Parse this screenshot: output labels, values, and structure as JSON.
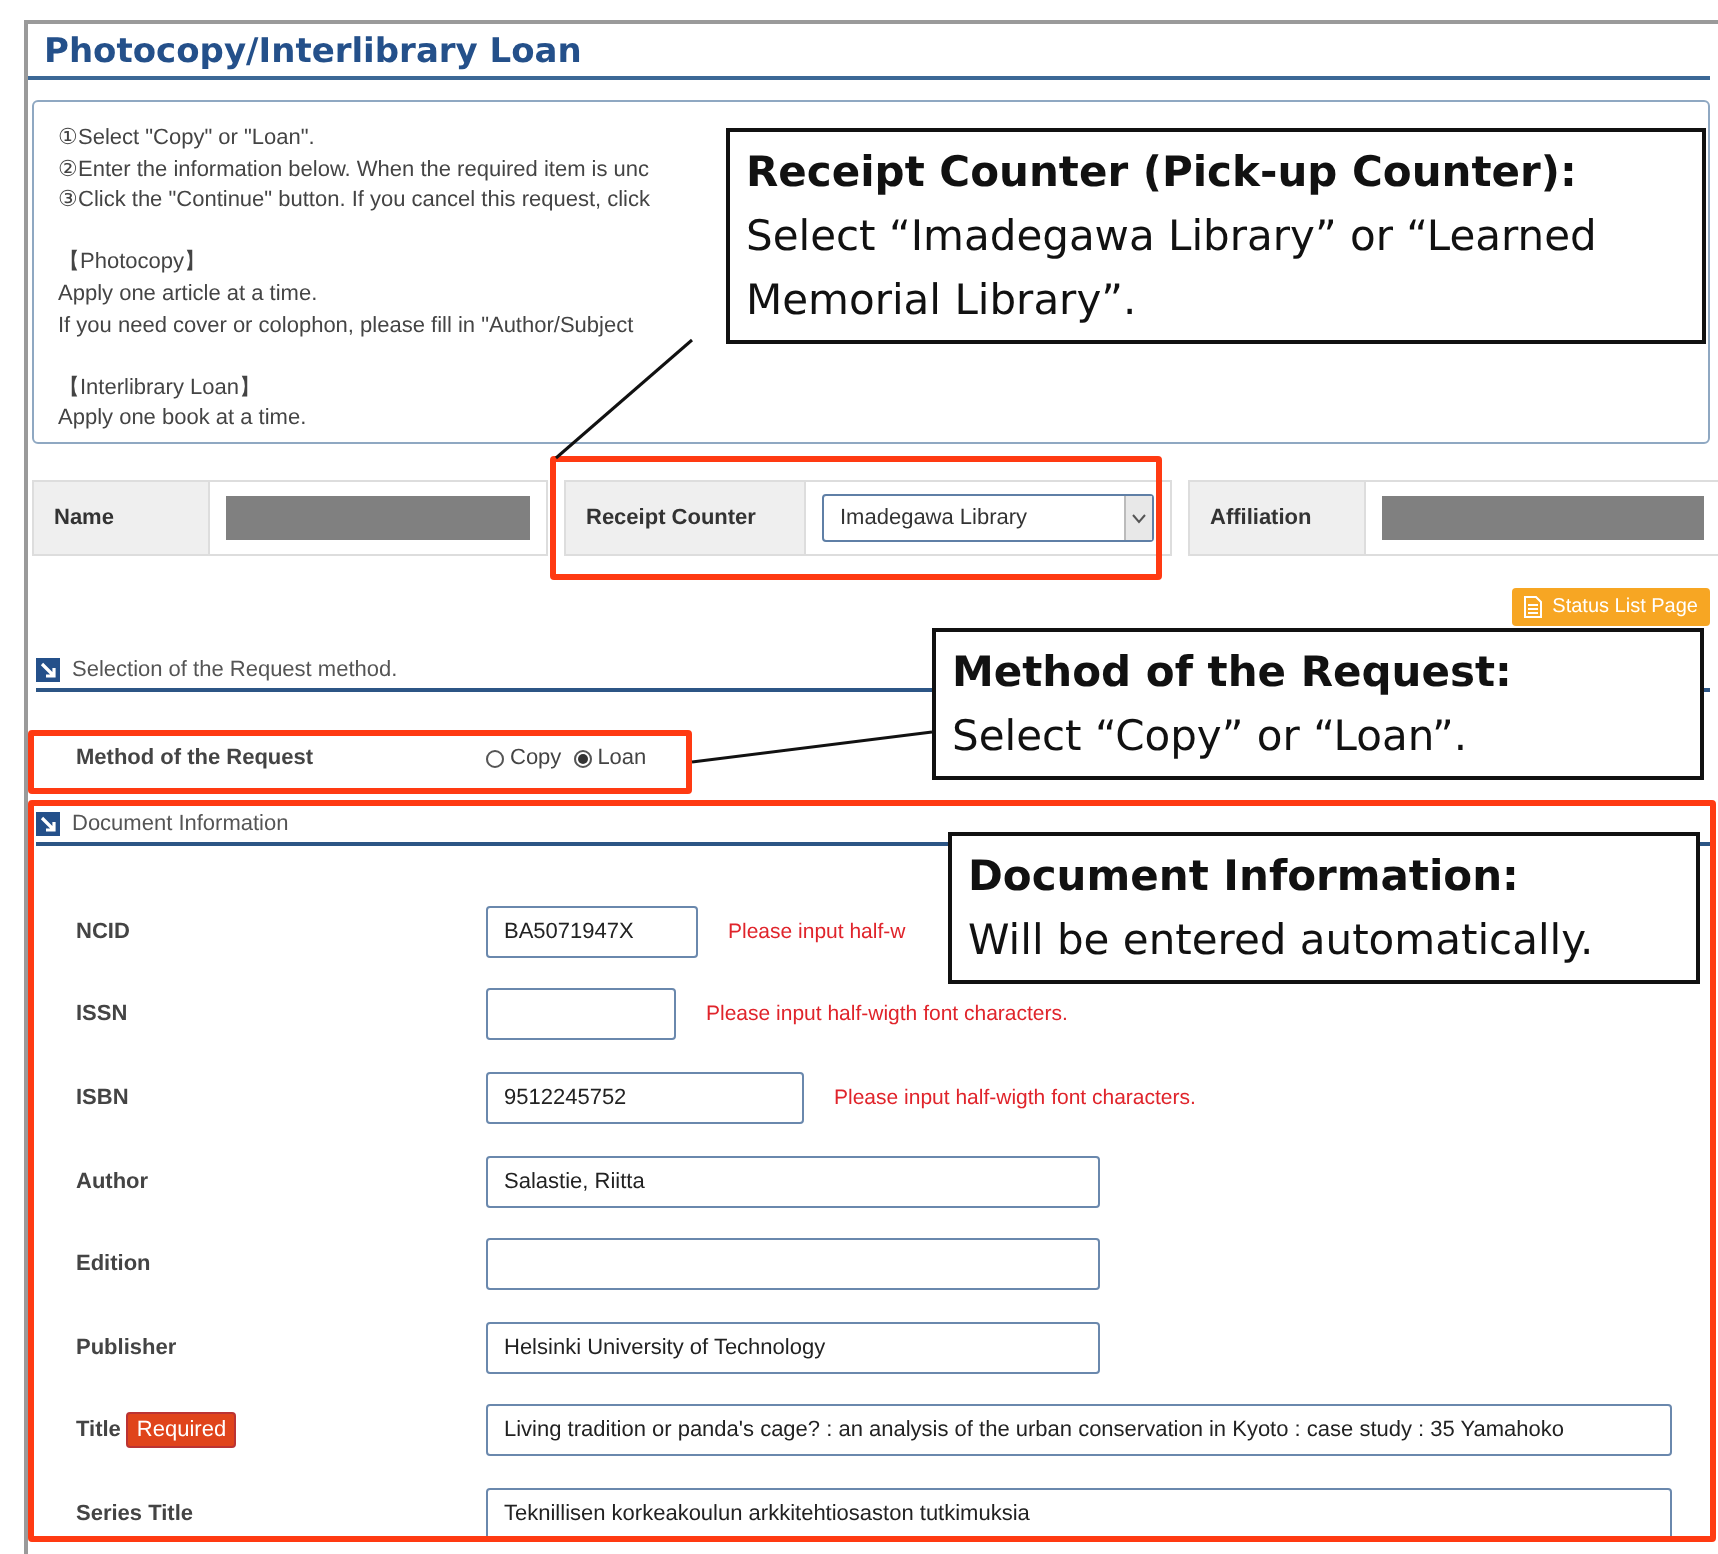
{
  "page_title": "Photocopy/Interlibrary Loan",
  "instructions": [
    [
      "①Select \"Copy\" or \"Loan\".",
      "②Enter the information below. When the required item is unc",
      "③Click the \"Continue\" button. If you cancel this request, click"
    ],
    [
      "【Photocopy】",
      "Apply one article at a time.",
      "If you need cover or colophon, please fill in \"Author/Subject"
    ],
    [
      "【Interlibrary Loan】",
      "Apply one book at a time."
    ]
  ],
  "request_info": [
    {
      "kind": "redacted",
      "label": "Name"
    },
    {
      "kind": "select",
      "label": "Receipt Counter",
      "value": "Imadegawa Library"
    },
    {
      "kind": "redacted",
      "label": "Affiliation"
    }
  ],
  "status_button": "Status List Page",
  "request_method": {
    "heading": "Selection of the Request method.",
    "label": "Method of the Request",
    "options": [
      {
        "label": "Copy",
        "selected": false
      },
      {
        "label": "Loan",
        "selected": true
      }
    ]
  },
  "document_information": {
    "heading": "Document Information",
    "fields": [
      {
        "label": "NCID",
        "value": "BA5071947X",
        "note": "Please input half-w"
      },
      {
        "label": "ISSN",
        "note": "Please input half-wigth font characters."
      },
      {
        "label": "ISBN",
        "value": "9512245752",
        "note": "Please input half-wigth font characters."
      },
      {
        "label": "Author",
        "value": "Salastie, Riitta"
      },
      {
        "label": "Edition"
      },
      {
        "label": "Publisher",
        "value": "Helsinki University of Technology"
      },
      {
        "label": "Title",
        "badge": "Required",
        "value": "Living tradition or panda's cage? : an analysis of the urban conservation in Kyoto : case study : 35 Yamahoko"
      },
      {
        "label": "Series Title",
        "value": "Teknillisen korkeakoulun arkkitehtiosaston tutkimuksia"
      }
    ]
  },
  "callouts": [
    {
      "title": "Receipt Counter (Pick-up Counter):",
      "text": "Select “Imadegawa Library” or “Learned Memorial Library”."
    },
    {
      "title": "Method of the Request:",
      "text": "Select “Copy” or “Loan”."
    },
    {
      "title": "Document Information:",
      "text": "Will be entered automatically."
    }
  ]
}
